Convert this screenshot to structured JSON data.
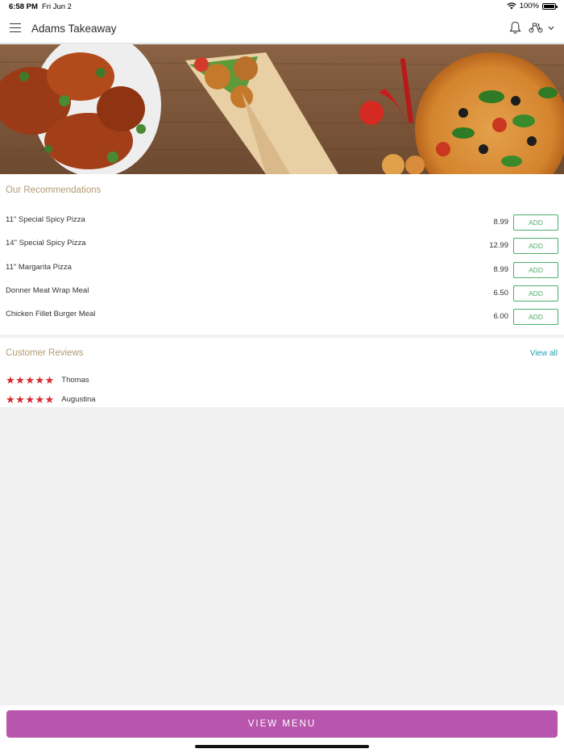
{
  "status_bar": {
    "time": "6:58 PM",
    "date": "Fri Jun 2",
    "battery": "100%",
    "icons": [
      "wifi-icon",
      "battery-icon"
    ]
  },
  "app_bar": {
    "title": "Adams Takeaway",
    "icons": [
      "menu-icon",
      "bell-icon",
      "scooter-icon",
      "chevron-down-icon"
    ]
  },
  "hero": {
    "description_icons": [
      "grilled-chicken",
      "wrap",
      "pizza",
      "chili",
      "tomato"
    ]
  },
  "recommendations": {
    "title": "Our Recommendations",
    "add_label": "ADD",
    "items": [
      {
        "name": "11\" Special Spicy Pizza",
        "price": "8.99"
      },
      {
        "name": "14\" Special Spicy Pizza",
        "price": "12.99"
      },
      {
        "name": "11\" Margarita Pizza",
        "price": "8.99"
      },
      {
        "name": "Donner Meat Wrap Meal",
        "price": "6.50"
      },
      {
        "name": "Chicken Fillet Burger Meal",
        "price": "6.00"
      }
    ]
  },
  "reviews": {
    "title": "Customer Reviews",
    "view_all": "View all",
    "items": [
      {
        "name": "Thomas",
        "rating": 5
      },
      {
        "name": "Augustina",
        "rating": 5
      }
    ]
  },
  "cta": {
    "label": "VIEW MENU"
  },
  "colors": {
    "accent_green": "#4cae6c",
    "section_title": "#b39a73",
    "link": "#2a9fb5",
    "cta": "#b856ad",
    "star": "#d8262e",
    "background": "#f1f1f1"
  }
}
